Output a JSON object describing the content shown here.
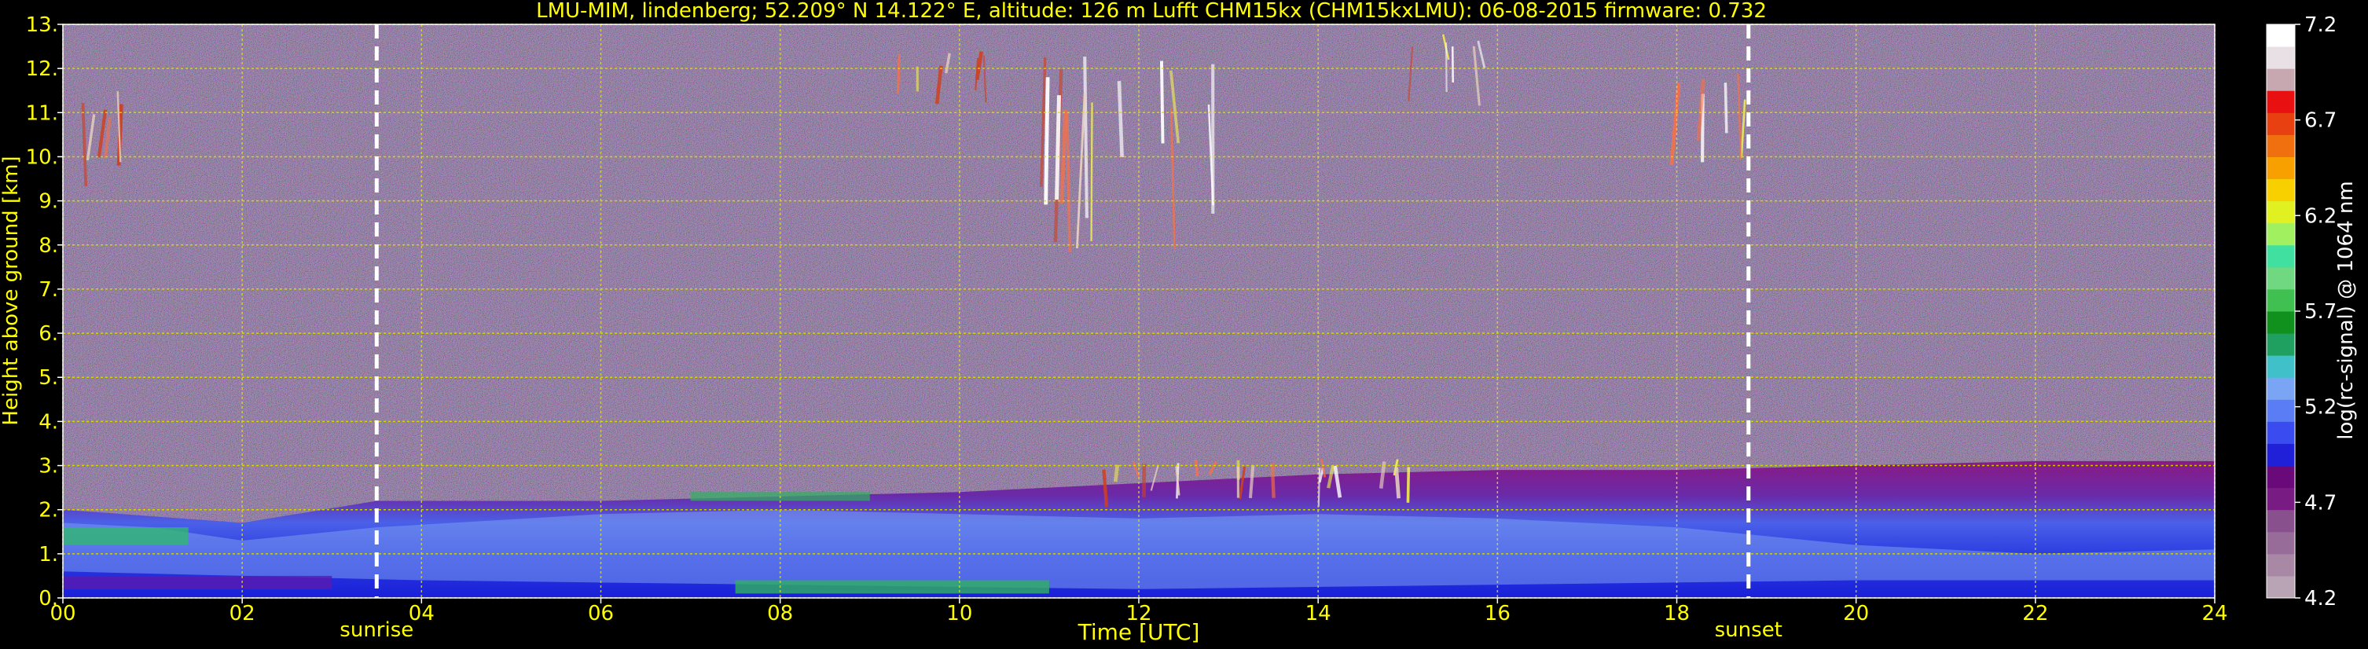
{
  "chart_data": {
    "type": "heatmap",
    "title": "LMU-MIM, lindenberg; 52.209° N 14.122° E, altitude: 126 m    Lufft CHM15kx (CHM15kxLMU): 06-08-2015    firmware: 0.732",
    "xlabel": "Time [UTC]",
    "ylabel": "Height above ground [km]",
    "xlim": [
      0,
      24
    ],
    "ylim": [
      0,
      13
    ],
    "x_ticks": [
      {
        "value": 0,
        "label": "00"
      },
      {
        "value": 2,
        "label": "02"
      },
      {
        "value": 4,
        "label": "04"
      },
      {
        "value": 6,
        "label": "06"
      },
      {
        "value": 8,
        "label": "08"
      },
      {
        "value": 10,
        "label": "10"
      },
      {
        "value": 12,
        "label": "12"
      },
      {
        "value": 14,
        "label": "14"
      },
      {
        "value": 16,
        "label": "16"
      },
      {
        "value": 18,
        "label": "18"
      },
      {
        "value": 20,
        "label": "20"
      },
      {
        "value": 22,
        "label": "22"
      },
      {
        "value": 24,
        "label": "24"
      }
    ],
    "y_ticks": [
      {
        "value": 0,
        "label": "0."
      },
      {
        "value": 1,
        "label": "1."
      },
      {
        "value": 2,
        "label": "2."
      },
      {
        "value": 3,
        "label": "3."
      },
      {
        "value": 4,
        "label": "4."
      },
      {
        "value": 5,
        "label": "5."
      },
      {
        "value": 6,
        "label": "6."
      },
      {
        "value": 7,
        "label": "7."
      },
      {
        "value": 8,
        "label": "8."
      },
      {
        "value": 9,
        "label": "9."
      },
      {
        "value": 10,
        "label": "10."
      },
      {
        "value": 11,
        "label": "11."
      },
      {
        "value": 12,
        "label": "12."
      },
      {
        "value": 13,
        "label": "13."
      }
    ],
    "grid": true,
    "colorbar": {
      "label": "log(rc-signal) @ 1064 nm",
      "range": [
        4.2,
        7.2
      ],
      "ticks": [
        "7.2",
        "6.7",
        "6.2",
        "5.7",
        "5.2",
        "4.7",
        "4.2"
      ],
      "colors": [
        "#b8a4b4",
        "#a888a4",
        "#986c98",
        "#88508c",
        "#781c84",
        "#6a0a7a",
        "#2020d8",
        "#3a4cf0",
        "#5a7cf4",
        "#7aa4f4",
        "#40c0c8",
        "#20a060",
        "#10901c",
        "#40c050",
        "#70d880",
        "#40e0a0",
        "#a0f060",
        "#e0f020",
        "#f8d000",
        "#f8a000",
        "#f07010",
        "#e84010",
        "#e81010",
        "#c8a8b0",
        "#e8e0e4",
        "#ffffff"
      ]
    },
    "annotations": [
      {
        "x": 3.5,
        "label": "sunrise"
      },
      {
        "x": 18.8,
        "label": "sunset"
      }
    ],
    "clouds": [
      {
        "x_start": 0.2,
        "x_end": 0.7,
        "y_base": 9.1,
        "y_top": 11.6
      },
      {
        "x_start": 9.3,
        "x_end": 10.4,
        "y_base": 11.2,
        "y_top": 12.4
      },
      {
        "x_start": 10.6,
        "x_end": 12.9,
        "y_base": 7.8,
        "y_top": 12.3
      },
      {
        "x_start": 15.0,
        "x_end": 15.9,
        "y_base": 11.4,
        "y_top": 12.9
      },
      {
        "x_start": 17.9,
        "x_end": 18.9,
        "y_base": 9.6,
        "y_top": 11.9
      },
      {
        "x_start": 11.6,
        "x_end": 15.3,
        "y_base": 2.2,
        "y_top": 3.2
      }
    ],
    "boundary_layer": [
      {
        "x": 0,
        "y": 2.0
      },
      {
        "x": 2,
        "y": 1.7
      },
      {
        "x": 3.5,
        "y": 2.2
      },
      {
        "x": 6,
        "y": 2.2
      },
      {
        "x": 8,
        "y": 2.3
      },
      {
        "x": 10,
        "y": 2.4
      },
      {
        "x": 12,
        "y": 2.6
      },
      {
        "x": 14,
        "y": 2.8
      },
      {
        "x": 16,
        "y": 2.9
      },
      {
        "x": 18,
        "y": 2.9
      },
      {
        "x": 20,
        "y": 3.0
      },
      {
        "x": 22,
        "y": 3.1
      },
      {
        "x": 24,
        "y": 3.1
      }
    ]
  }
}
